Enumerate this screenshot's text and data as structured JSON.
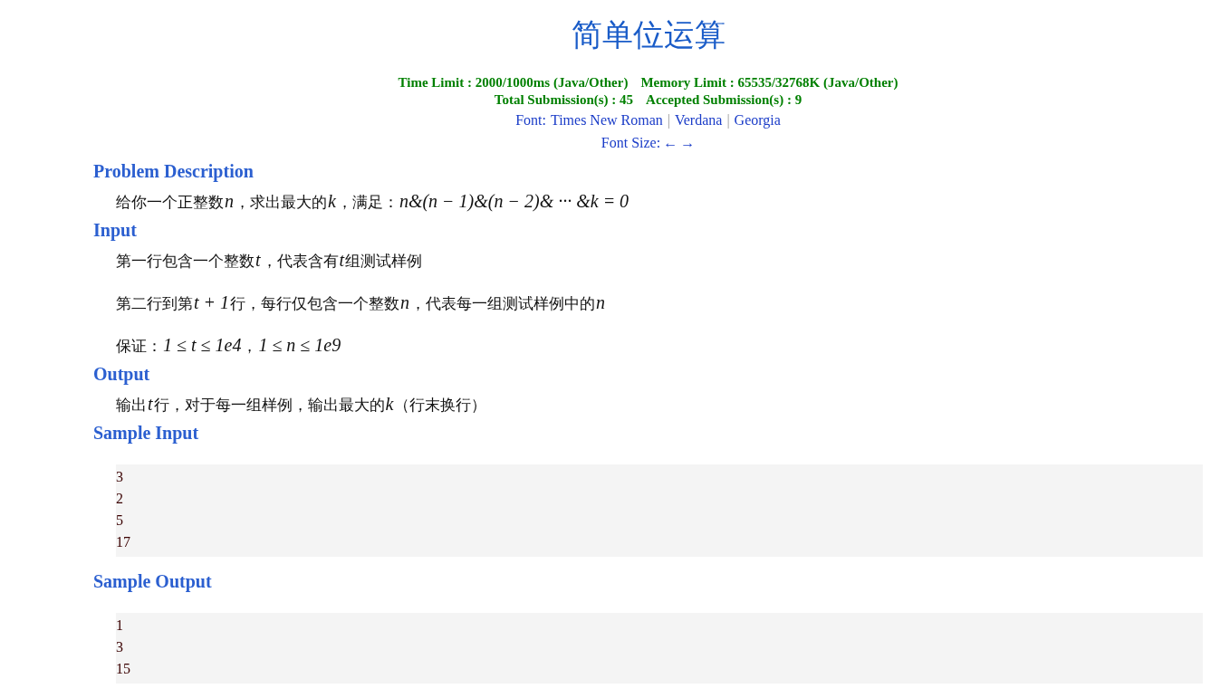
{
  "title": "简单位运算",
  "limits": [
    "Time Limit : 2000/1000ms (Java/Other)",
    "Memory Limit : 65535/32768K (Java/Other)"
  ],
  "submissions": [
    "Total Submission(s) : 45",
    "Accepted Submission(s) : 9"
  ],
  "font_switch": {
    "label": "Font:",
    "options": [
      "Times New Roman",
      "Verdana",
      "Georgia"
    ],
    "separator": "|"
  },
  "font_size": {
    "label": "Font Size:",
    "options": [
      "←",
      "→"
    ]
  },
  "sections": [
    {
      "heading": "Problem Description",
      "kind": "text",
      "lines": [
        [
          {
            "text": "给你一个正整数",
            "math": false
          },
          {
            "text": "n",
            "math": true
          },
          {
            "text": "，求出最大的",
            "math": false
          },
          {
            "text": "k",
            "math": true
          },
          {
            "text": "，满足：",
            "math": false
          },
          {
            "text": "n&(n − 1)&(n − 2)& ··· &k = 0",
            "math": true
          }
        ]
      ]
    },
    {
      "heading": "Input",
      "kind": "text",
      "lines": [
        [
          {
            "text": "第一行包含一个整数",
            "math": false
          },
          {
            "text": "t",
            "math": true
          },
          {
            "text": "，代表含有",
            "math": false
          },
          {
            "text": "t",
            "math": true
          },
          {
            "text": "组测试样例",
            "math": false
          }
        ],
        [
          {
            "text": "第二行到第",
            "math": false
          },
          {
            "text": "t + 1",
            "math": true
          },
          {
            "text": "行，每行仅包含一个整数",
            "math": false
          },
          {
            "text": "n",
            "math": true
          },
          {
            "text": "，代表每一组测试样例中的",
            "math": false
          },
          {
            "text": "n",
            "math": true
          }
        ],
        [
          {
            "text": "保证：",
            "math": false
          },
          {
            "text": "1 ≤ t ≤ 1e4",
            "math": true
          },
          {
            "text": "，",
            "math": false
          },
          {
            "text": "1 ≤ n ≤ 1e9",
            "math": true
          }
        ]
      ]
    },
    {
      "heading": "Output",
      "kind": "text",
      "lines": [
        [
          {
            "text": "输出",
            "math": false
          },
          {
            "text": "t",
            "math": true
          },
          {
            "text": "行，对于每一组样例，输出最大的",
            "math": false
          },
          {
            "text": "k",
            "math": true
          },
          {
            "text": "（行末换行）",
            "math": false
          }
        ]
      ]
    },
    {
      "heading": "Sample Input",
      "kind": "sample",
      "lines": [
        "3",
        "2",
        "5",
        "17"
      ]
    },
    {
      "heading": "Sample Output",
      "kind": "sample",
      "lines": [
        "1",
        "3",
        "15"
      ]
    }
  ]
}
